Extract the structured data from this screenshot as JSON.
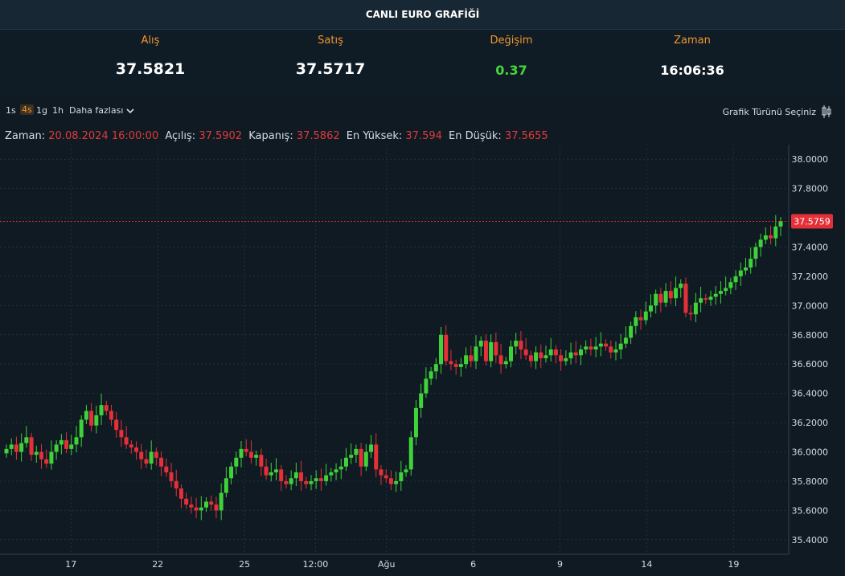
{
  "header": {
    "title": "CANLI EURO GRAFİĞİ"
  },
  "stats": [
    {
      "label": "Alış",
      "value": "37.5821"
    },
    {
      "label": "Satış",
      "value": "37.5717"
    },
    {
      "label": "Değişim",
      "value": "0.37"
    },
    {
      "label": "Zaman",
      "value": "16:06:36"
    }
  ],
  "toolbar": {
    "timeframes": [
      "1s",
      "4s",
      "1g",
      "1h"
    ],
    "active_timeframe": "4s",
    "more_label": "Daha fazlası",
    "chart_type_label": "Grafik Türünü Seçiniz"
  },
  "legend": {
    "time_key": "Zaman:",
    "time_val": "20.08.2024 16:00:00",
    "open_key": "Açılış:",
    "open_val": "37.5902",
    "close_key": "Kapanış:",
    "close_val": "37.5862",
    "high_key": "En Yüksek:",
    "high_val": "37.594",
    "low_key": "En Düşük:",
    "low_val": "37.5655"
  },
  "colors": {
    "up": "#3fd23a",
    "down": "#e5303a",
    "accent": "#f0962e",
    "price_line": "#e5303a",
    "grid": "#1f3340"
  },
  "chart_data": {
    "type": "candlestick",
    "ylim": [
      35.3,
      38.1
    ],
    "y_ticks": [
      "38.0000",
      "37.8000",
      "37.6000",
      "37.4000",
      "37.2000",
      "37.0000",
      "36.8000",
      "36.6000",
      "36.4000",
      "36.2000",
      "36.0000",
      "35.8000",
      "35.6000",
      "35.4000"
    ],
    "x_tick_labels": [
      "17",
      "22",
      "25",
      "12:00",
      "Ağu",
      "6",
      "9",
      "14",
      "19"
    ],
    "last_price_label": "37.5759",
    "last_price": 37.5759,
    "closes": [
      36.02,
      36.05,
      36.0,
      36.06,
      36.1,
      35.98,
      36.0,
      35.95,
      35.92,
      36.0,
      36.05,
      36.08,
      36.02,
      36.05,
      36.1,
      36.22,
      36.28,
      36.18,
      36.25,
      36.32,
      36.28,
      36.22,
      36.15,
      36.1,
      36.05,
      36.03,
      36.0,
      35.95,
      35.92,
      36.0,
      35.96,
      35.9,
      35.86,
      35.8,
      35.75,
      35.68,
      35.64,
      35.62,
      35.6,
      35.62,
      35.66,
      35.64,
      35.6,
      35.72,
      35.82,
      35.9,
      35.96,
      36.02,
      36.0,
      35.96,
      35.98,
      35.9,
      35.84,
      35.86,
      35.88,
      35.8,
      35.78,
      35.82,
      35.86,
      35.8,
      35.78,
      35.8,
      35.82,
      35.8,
      35.84,
      35.86,
      35.88,
      35.9,
      35.96,
      35.98,
      36.02,
      35.9,
      36.0,
      36.05,
      35.88,
      35.84,
      35.82,
      35.78,
      35.8,
      35.86,
      35.88,
      36.1,
      36.3,
      36.4,
      36.5,
      36.55,
      36.6,
      36.8,
      36.62,
      36.6,
      36.58,
      36.6,
      36.66,
      36.62,
      36.72,
      36.76,
      36.62,
      36.75,
      36.66,
      36.6,
      36.62,
      36.72,
      36.76,
      36.7,
      36.66,
      36.62,
      36.68,
      36.64,
      36.66,
      36.7,
      36.66,
      36.62,
      36.64,
      36.68,
      36.66,
      36.7,
      36.72,
      36.7,
      36.72,
      36.74,
      36.72,
      36.68,
      36.7,
      36.74,
      36.78,
      36.86,
      36.92,
      36.9,
      36.96,
      37.0,
      37.08,
      37.02,
      37.1,
      37.05,
      37.12,
      37.15,
      36.95,
      36.94,
      37.02,
      37.05,
      37.04,
      37.06,
      37.08,
      37.1,
      37.12,
      37.16,
      37.2,
      37.24,
      37.26,
      37.32,
      37.4,
      37.45,
      37.48,
      37.46,
      37.54,
      37.5759
    ]
  }
}
